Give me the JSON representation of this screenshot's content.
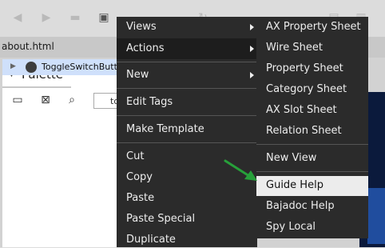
{
  "tab": {
    "title": "about.html"
  },
  "palette": {
    "title": "Palette",
    "search_value": "to",
    "tree_item": "ToggleSwitchButto"
  },
  "main_menu": {
    "items": [
      "Views",
      "Actions",
      "New",
      "Edit Tags",
      "Make Template",
      "Cut",
      "Copy",
      "Paste",
      "Paste Special",
      "Duplicate"
    ]
  },
  "sub_menu": {
    "items": [
      "AX Property Sheet",
      "Wire Sheet",
      "Property Sheet",
      "Category Sheet",
      "AX Slot Sheet",
      "Relation Sheet",
      "New View",
      "Guide Help",
      "Bajadoc Help",
      "Spy Local"
    ]
  },
  "colors": {
    "menu_bg": "#2b2b2b",
    "highlight": "#ececec",
    "arrow": "#27a03a"
  }
}
